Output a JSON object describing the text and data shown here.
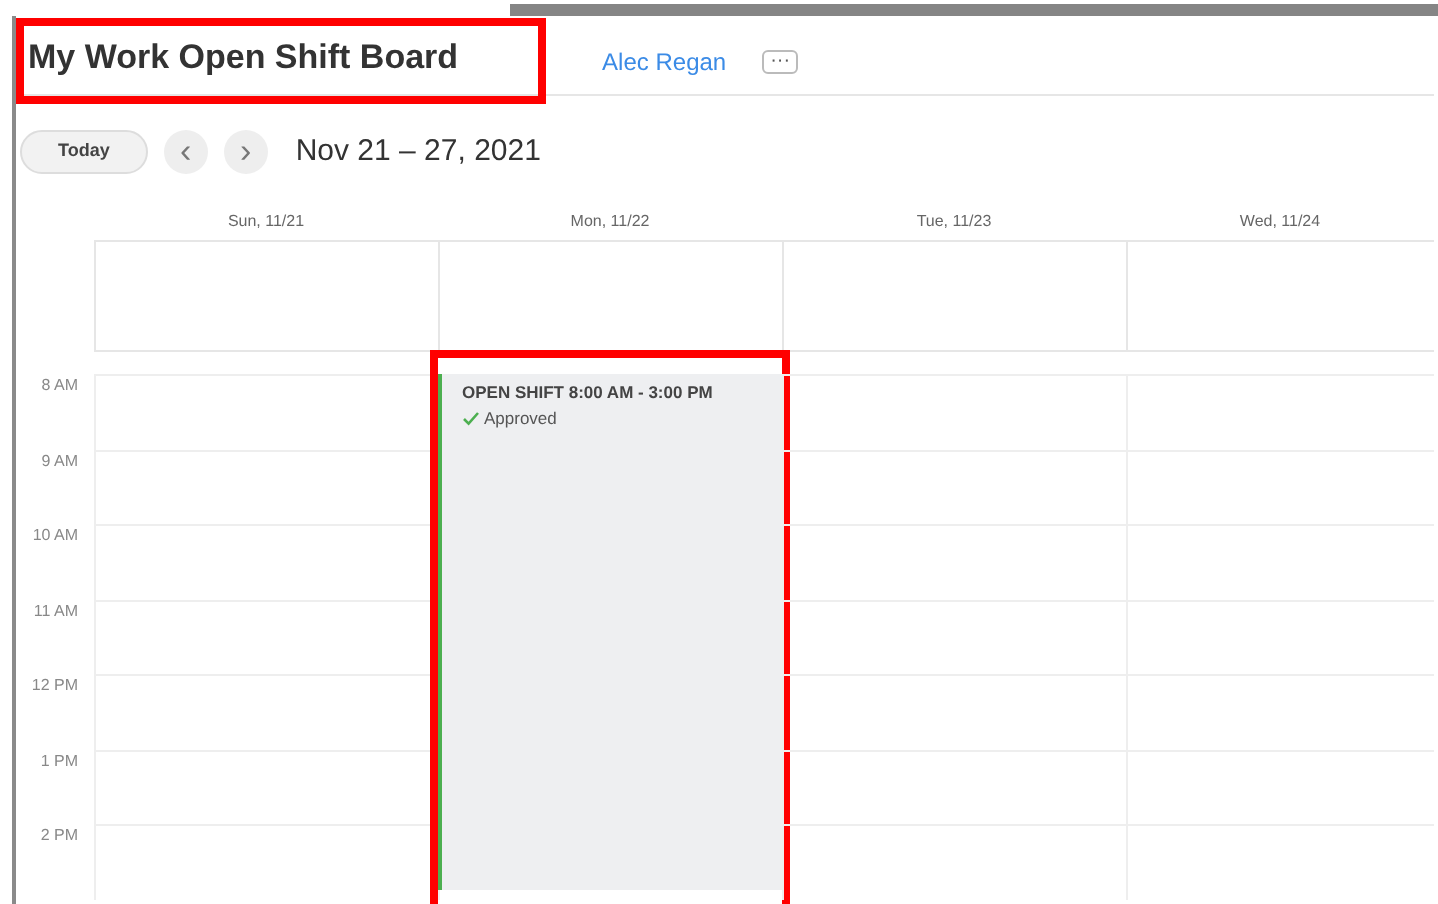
{
  "header": {
    "title": "My Work Open Shift Board",
    "title_highlighted": true,
    "user_name": "Alec Regan",
    "more_label": "···"
  },
  "toolbar": {
    "today_label": "Today",
    "prev_label": "‹",
    "next_label": "›",
    "date_range": "Nov 21 – 27, 2021"
  },
  "time_slots": [
    "8 AM",
    "9 AM",
    "10 AM",
    "11 AM",
    "12 PM",
    "1 PM",
    "2 PM"
  ],
  "days": [
    {
      "label": "Sun, 11/21"
    },
    {
      "label": "Mon, 11/22",
      "events": [
        {
          "title": "OPEN SHIFT 8:00 AM - 3:00 PM",
          "status": "Approved",
          "color": "#4caf50",
          "highlighted": true
        }
      ]
    },
    {
      "label": "Tue, 11/23"
    },
    {
      "label": "Wed, 11/24"
    }
  ]
}
